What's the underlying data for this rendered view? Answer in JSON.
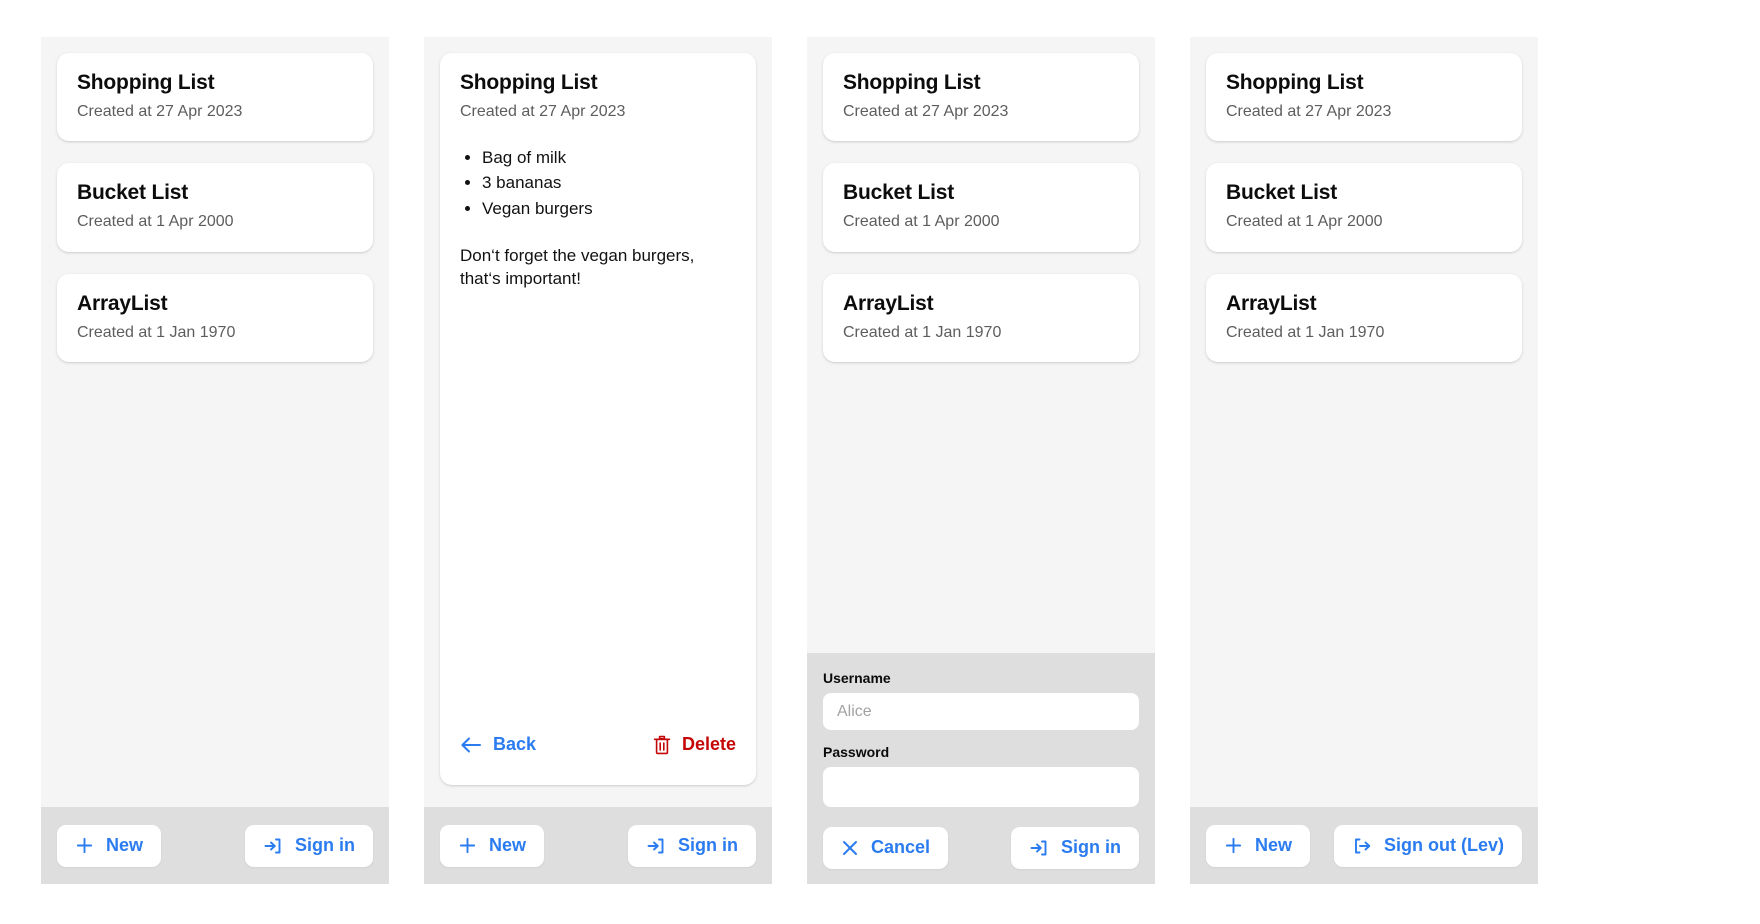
{
  "lists": [
    {
      "title": "Shopping List",
      "subtitle": "Created at 27 Apr 2023"
    },
    {
      "title": "Bucket List",
      "subtitle": "Created at 1 Apr 2000"
    },
    {
      "title": "ArrayList",
      "subtitle": "Created at 1 Jan 1970"
    }
  ],
  "detail": {
    "title": "Shopping List",
    "subtitle": "Created at 27 Apr 2023",
    "items": [
      "Bag of milk",
      "3 bananas",
      "Vegan burgers"
    ],
    "note": "Don‘t forget the vegan burgers, that‘s important!",
    "back_label": "Back",
    "back_icon": "arrow-left-icon",
    "delete_label": "Delete",
    "delete_icon": "trash-icon"
  },
  "toolbar": {
    "new_label": "New",
    "new_icon": "plus-icon",
    "signin_label": "Sign in",
    "signin_icon": "sign-in-icon",
    "signout_label": "Sign out (Lev)",
    "signout_icon": "sign-out-icon"
  },
  "login": {
    "username_label": "Username",
    "username_value": "",
    "username_placeholder": "Alice",
    "password_label": "Password",
    "password_value": "",
    "password_placeholder": "",
    "cancel_label": "Cancel",
    "cancel_icon": "close-icon",
    "signin_label": "Sign in",
    "signin_icon": "sign-in-icon"
  },
  "colors": {
    "accent_blue": "#2b7cf0",
    "danger_red": "#c40707",
    "panel_bg": "#f5f5f5",
    "toolbar_bg": "#dedede",
    "card_bg": "#ffffff"
  }
}
